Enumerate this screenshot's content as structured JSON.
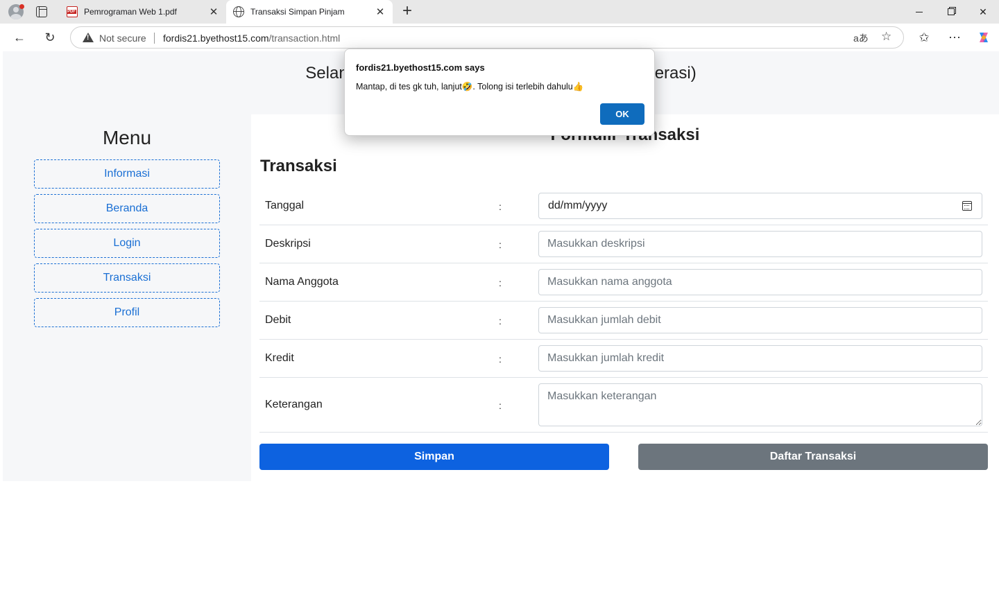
{
  "browser": {
    "tabs": [
      {
        "title": "Pemrograman Web 1.pdf",
        "icon": "pdf-icon",
        "active": false
      },
      {
        "title": "Transaksi Simpan Pinjam",
        "icon": "globe-icon",
        "active": true
      }
    ],
    "security_label": "Not secure",
    "url_host": "fordis21.byethost15.com",
    "url_path": "/transaction.html",
    "read_aloud_label": "aあ"
  },
  "page": {
    "header_title_left": "Selan",
    "header_title_right": "erasi)",
    "form_heading": "Formulir Transaksi",
    "section_title": "Transaksi"
  },
  "sidebar": {
    "title": "Menu",
    "items": [
      {
        "label": "Informasi"
      },
      {
        "label": "Beranda"
      },
      {
        "label": "Login"
      },
      {
        "label": "Transaksi"
      },
      {
        "label": "Profil"
      }
    ]
  },
  "form": {
    "rows": [
      {
        "label": "Tanggal",
        "value": "dd/mm/yyyy"
      },
      {
        "label": "Deskripsi",
        "placeholder": "Masukkan deskripsi"
      },
      {
        "label": "Nama Anggota",
        "placeholder": "Masukkan nama anggota"
      },
      {
        "label": "Debit",
        "placeholder": "Masukkan jumlah debit"
      },
      {
        "label": "Kredit",
        "placeholder": "Masukkan jumlah kredit"
      },
      {
        "label": "Keterangan",
        "placeholder": "Masukkan keterangan"
      }
    ],
    "colon": ":",
    "save_label": "Simpan",
    "list_label": "Daftar Transaksi",
    "primary_color": "#0d62e0",
    "secondary_color": "#6c757d"
  },
  "dialog": {
    "title": "fordis21.byethost15.com says",
    "message": "Mantap, di tes gk tuh, lanjut🤣. Tolong isi terlebih dahulu👍",
    "ok_label": "OK"
  }
}
